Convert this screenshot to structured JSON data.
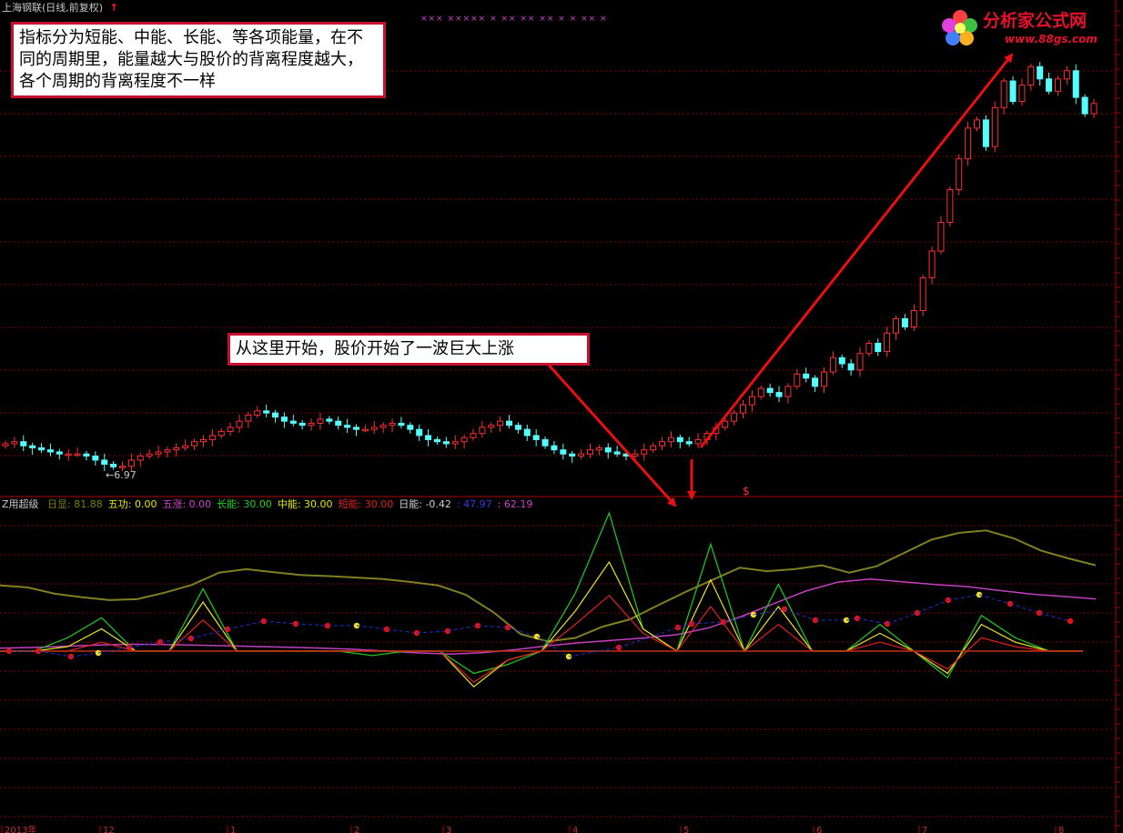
{
  "header": {
    "title": "上海钢联(日线,前复权)",
    "marker": "↑"
  },
  "logo": {
    "text": "分析家公式网",
    "url": "www.88gs.com"
  },
  "annotations": {
    "note1": "指标分为短能、中能、长能、等各项能量，在不同的周期里，能量越大与股价的背离程度越大，各个周期的背离程度不一样",
    "note2": "从这里开始，股价开始了一波巨大上涨",
    "low_label": "←6.97",
    "signal_mark": "$",
    "top_marks": "×××  ××××× ×  ×× ××  ××   × × ×× ×"
  },
  "indicator": {
    "name": "Z用超级",
    "items": [
      {
        "label": "日显:",
        "value": "81.88",
        "color": "#808000"
      },
      {
        "label": "五功:",
        "value": "0.00",
        "color": "#e8e800"
      },
      {
        "label": "五涨:",
        "value": "0.00",
        "color": "#d040d0"
      },
      {
        "label": "长能:",
        "value": "30.00",
        "color": "#20d020"
      },
      {
        "label": "中能:",
        "value": "30.00",
        "color": "#e8e800"
      },
      {
        "label": "短能:",
        "value": "30.00",
        "color": "#e02020"
      },
      {
        "label": "日能:",
        "value": "-0.42",
        "color": "#d0d0d0"
      },
      {
        "label": "",
        "value": ": 47.97",
        "color": "#3040e0"
      },
      {
        "label": "",
        "value": ": 62.19",
        "color": "#d040d0"
      }
    ]
  },
  "xaxis": {
    "labels": [
      "2013年",
      "12",
      "1",
      "2",
      "3",
      "4",
      "5",
      "6",
      "7",
      "8"
    ]
  },
  "colors": {
    "up": "#ff3030",
    "down": "#54ffff",
    "grid": "#8a0000",
    "arrow": "#e81010"
  },
  "chart_data": [
    {
      "type": "candlestick",
      "title": "上海钢联(日线,前复权)",
      "low_marker": 6.97,
      "close_approx": [
        8.1,
        8.2,
        8.0,
        7.9,
        7.8,
        7.7,
        7.6,
        7.6,
        7.6,
        7.5,
        7.3,
        7.1,
        6.97,
        7.0,
        7.3,
        7.5,
        7.6,
        7.7,
        7.8,
        7.9,
        8.0,
        8.2,
        8.3,
        8.5,
        8.7,
        8.9,
        9.2,
        9.5,
        9.7,
        9.6,
        9.4,
        9.2,
        9.1,
        9.0,
        9.1,
        9.3,
        9.2,
        9.0,
        8.9,
        8.8,
        8.8,
        8.9,
        9.0,
        9.1,
        9.0,
        8.8,
        8.5,
        8.3,
        8.2,
        8.1,
        8.2,
        8.4,
        8.6,
        8.9,
        9.0,
        9.2,
        9.0,
        8.8,
        8.5,
        8.3,
        8.0,
        7.8,
        7.6,
        7.5,
        7.6,
        7.8,
        7.9,
        7.7,
        7.6,
        7.5,
        7.6,
        7.8,
        8.0,
        8.2,
        8.4,
        8.2,
        8.1,
        8.3,
        8.6,
        8.9,
        9.2,
        9.6,
        10.0,
        10.4,
        10.8,
        10.6,
        10.4,
        10.9,
        11.5,
        11.3,
        10.9,
        11.6,
        12.3,
        12.0,
        11.7,
        12.5,
        13.0,
        12.6,
        13.5,
        14.2,
        13.8,
        14.6,
        16.2,
        17.5,
        18.9,
        20.5,
        22.0,
        23.5,
        23.9,
        22.6,
        24.5,
        25.8,
        24.8,
        25.6,
        26.5,
        25.9,
        25.3,
        25.9,
        26.3,
        25.0,
        24.2,
        24.7
      ]
    },
    {
      "type": "line",
      "title": "Z用超级",
      "series": [
        {
          "name": "日显",
          "values": [
            81.9,
            81.5,
            80.2,
            79.5,
            78.9,
            79.1,
            80.4,
            82.0,
            84.5,
            85.2,
            84.6,
            84.0,
            83.8,
            83.5,
            83.2,
            82.6,
            81.9,
            80.0,
            76.5,
            72.0,
            70.5,
            71.2,
            73.5,
            75.0,
            77.8,
            80.5,
            83.0,
            85.5,
            84.8,
            85.2,
            86.0,
            84.5,
            85.8,
            88.5,
            91.2,
            92.6,
            93.1,
            91.5,
            89.0,
            87.4,
            86.0
          ]
        },
        {
          "name": "五涨",
          "values": [
            50,
            50.2,
            50.6,
            51.0,
            51.3,
            51.2,
            51.0,
            50.8,
            50.5,
            50.3,
            50.0,
            49.6,
            49.0,
            48.4,
            48.0,
            48.5,
            49.5,
            50.8,
            51.8,
            52.6,
            53.4,
            54.5,
            56.8,
            60.5,
            64.8,
            69.0,
            72.0,
            73.0,
            72.1,
            71.2,
            70.5,
            69.2,
            68.0,
            67.2,
            66.4
          ]
        },
        {
          "name": "长能",
          "values": [
            30,
            30,
            36,
            45,
            30,
            30,
            58,
            30,
            30,
            30,
            30,
            28,
            30,
            30,
            20,
            24,
            30,
            56,
            92,
            40,
            30,
            78,
            30,
            60,
            30,
            30,
            42,
            30,
            18,
            46,
            36,
            30,
            30
          ]
        },
        {
          "name": "中能",
          "values": [
            30,
            30,
            32,
            40,
            30,
            30,
            52,
            30,
            30,
            30,
            30,
            30,
            30,
            30,
            14,
            26,
            30,
            48,
            70,
            40,
            30,
            62,
            30,
            50,
            30,
            30,
            38,
            30,
            20,
            42,
            34,
            30,
            30
          ]
        },
        {
          "name": "短能",
          "values": [
            30,
            30,
            30,
            34,
            30,
            30,
            44,
            30,
            30,
            30,
            30,
            30,
            30,
            30,
            16,
            26,
            30,
            42,
            55,
            38,
            30,
            50,
            30,
            42,
            30,
            30,
            34,
            30,
            22,
            36,
            32,
            30,
            30
          ]
        }
      ]
    }
  ]
}
